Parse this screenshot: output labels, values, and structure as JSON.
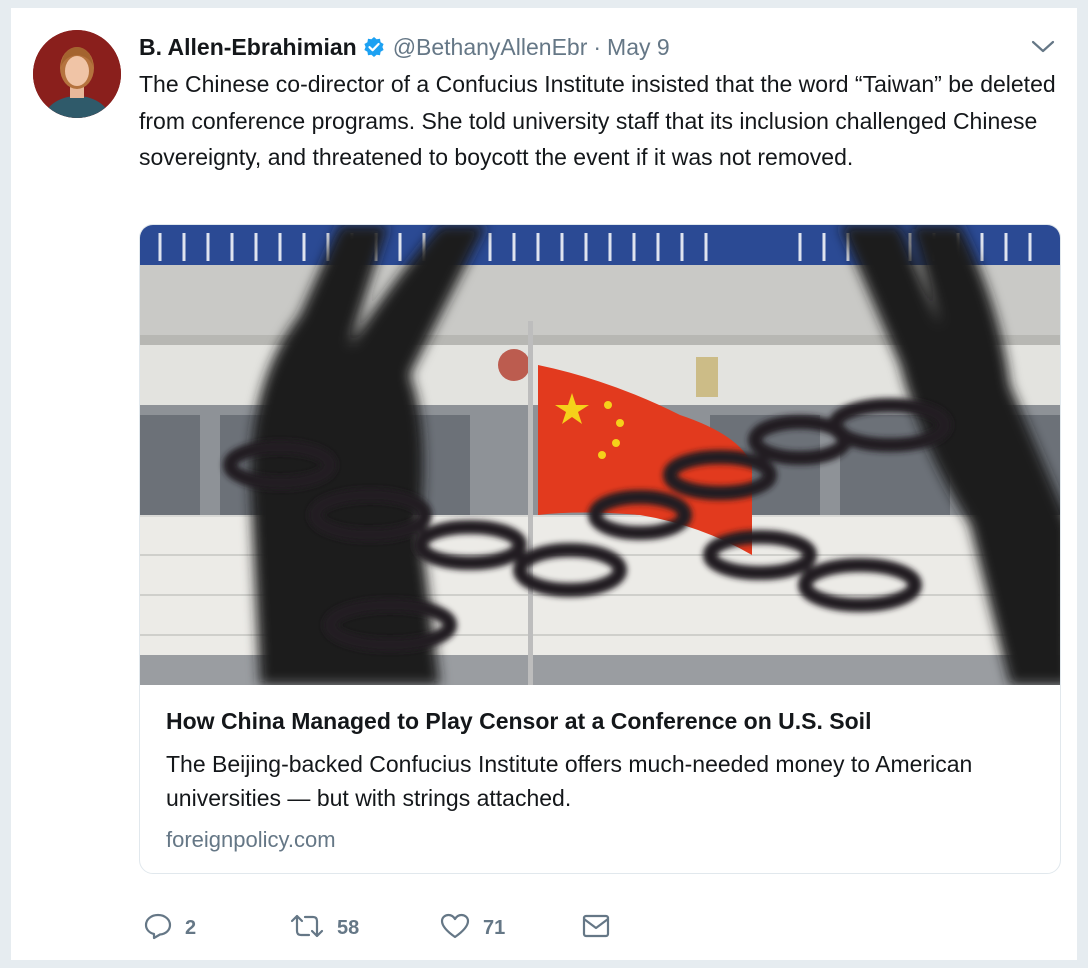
{
  "tweet": {
    "author_name": "B. Allen-Ebrahimian",
    "handle": "@BethanyAllenEbr",
    "separator": "·",
    "date": "May 9",
    "text": "The Chinese co-director of a Confucius Institute insisted that the word “Taiwan” be deleted from conference programs. She told university staff that its inclusion challenged Chinese sovereignty, and threatened to boycott the event if it was not removed."
  },
  "card": {
    "title": "How China Managed to Play Censor at a Conference on U.S. Soil",
    "description": "The Beijing-backed Confucius Institute offers much-needed money to American universities — but with strings attached.",
    "domain": "foreignpolicy.com"
  },
  "actions": {
    "reply_count": "2",
    "retweet_count": "58",
    "like_count": "71"
  },
  "colors": {
    "name": "#14171a",
    "secondary": "#657786",
    "verified": "#1da1f2",
    "border": "#e1e8ed",
    "flag_red": "#e23a1e",
    "flag_star": "#f5d11a"
  },
  "icons": {
    "verified": "verified-badge-icon",
    "caret": "chevron-down-icon",
    "reply": "reply-icon",
    "retweet": "retweet-icon",
    "like": "heart-icon",
    "dm": "envelope-icon"
  }
}
